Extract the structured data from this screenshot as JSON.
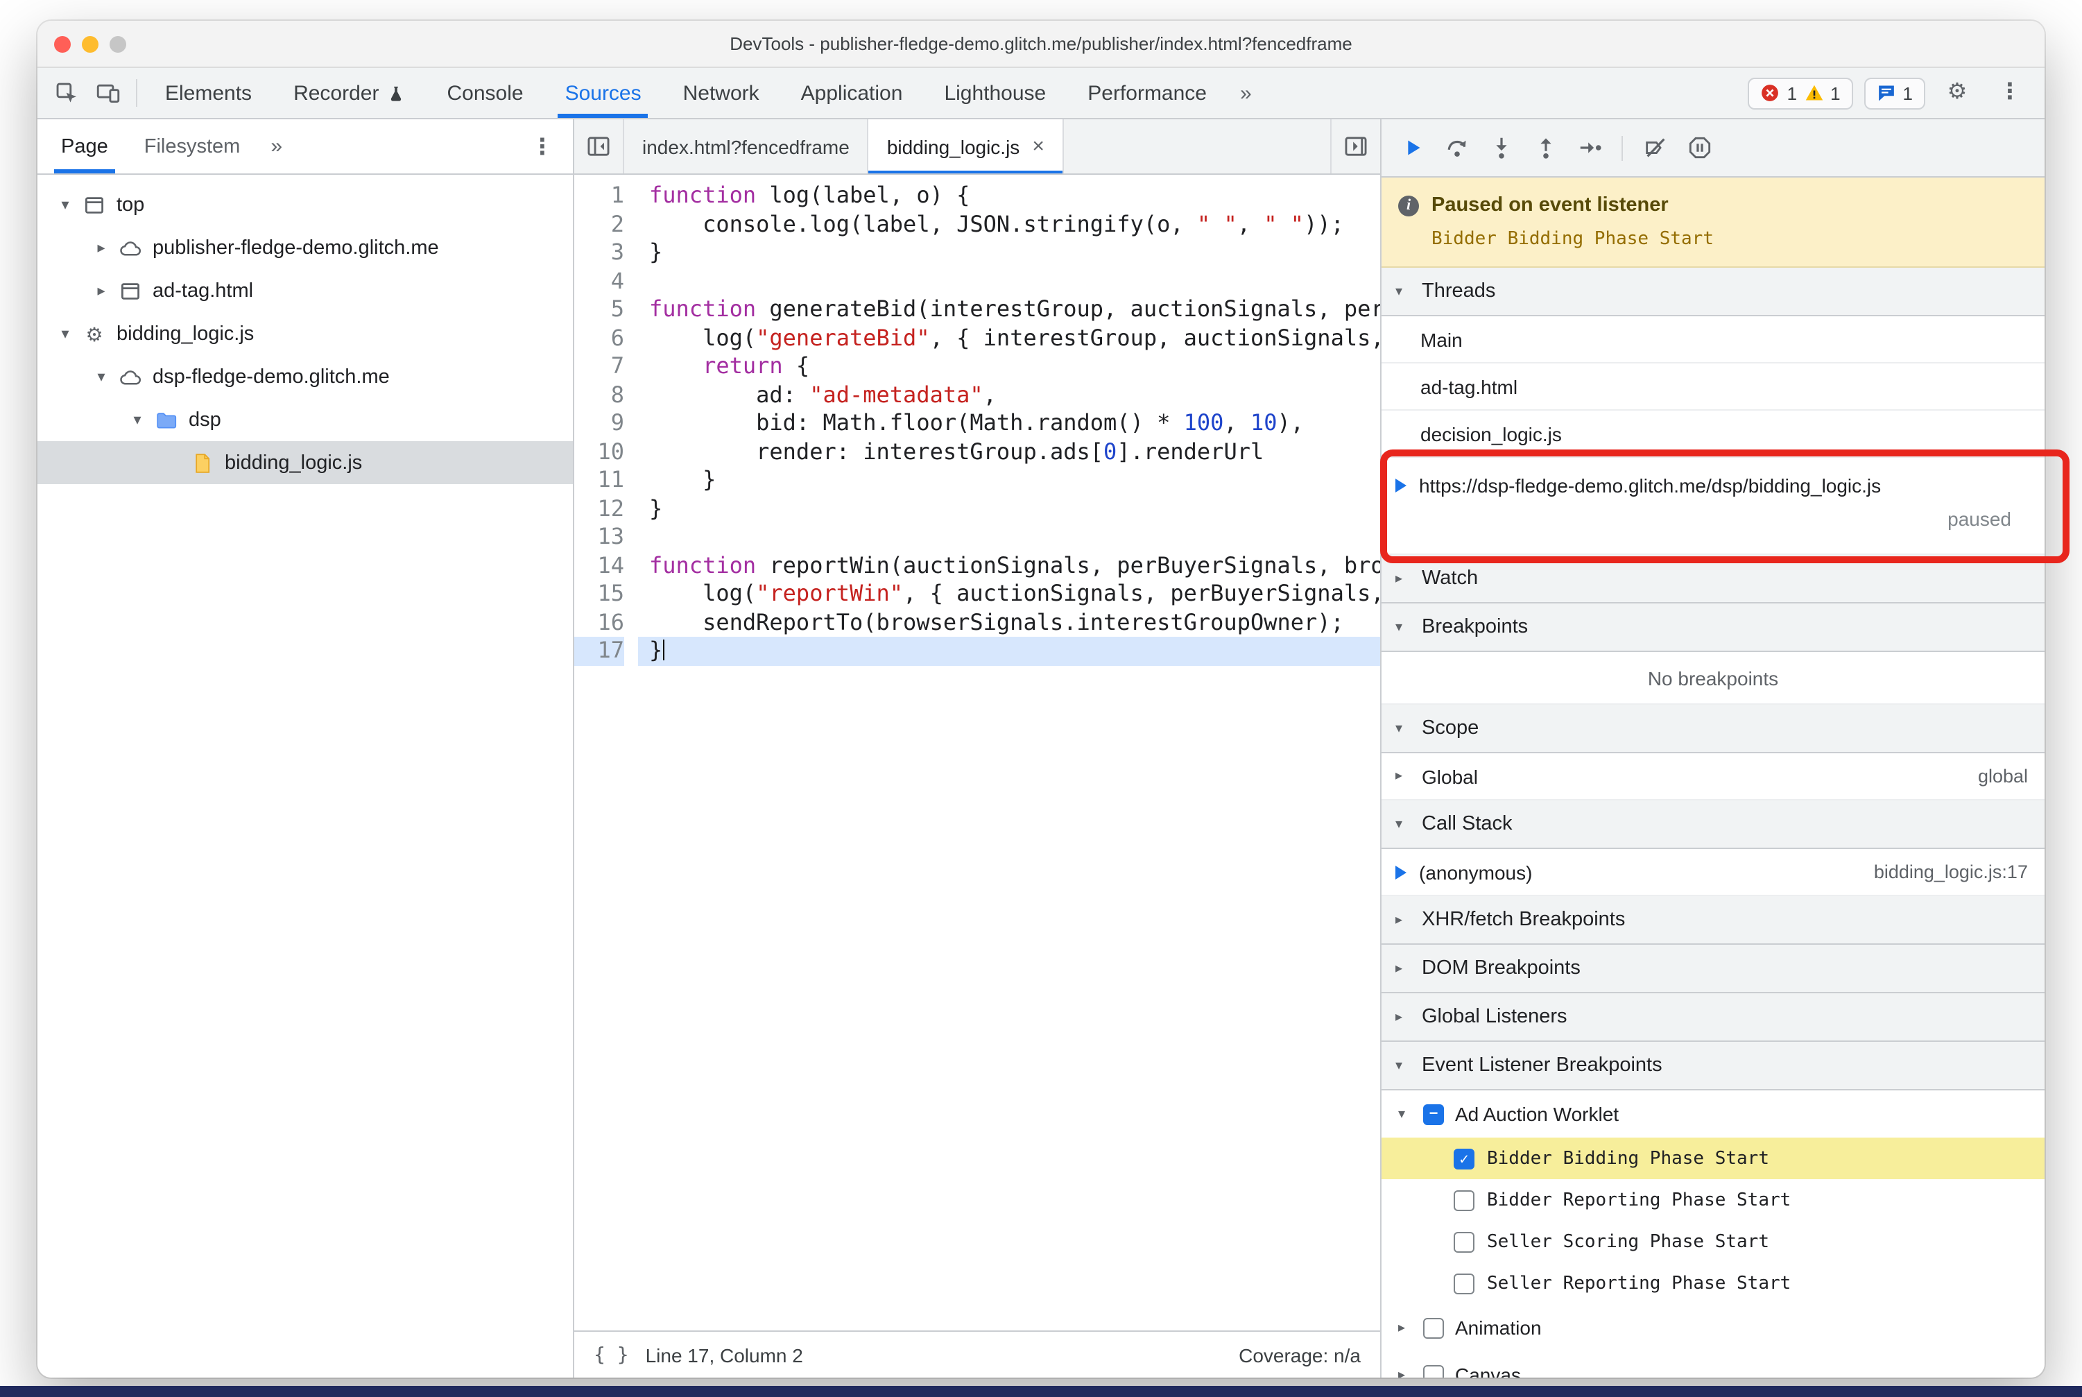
{
  "window": {
    "title": "DevTools - publisher-fledge-demo.glitch.me/publisher/index.html?fencedframe"
  },
  "toolbar": {
    "left_icons": [
      "inspect-icon",
      "device-toolbar-icon"
    ],
    "tabs": [
      "Elements",
      "Recorder",
      "Console",
      "Sources",
      "Network",
      "Application",
      "Lighthouse",
      "Performance"
    ],
    "selected_tab": "Sources",
    "overflow_label": "»",
    "badges": {
      "errors": "1",
      "warnings": "1",
      "issues": "1"
    },
    "right_icons": [
      "error-icon",
      "warning-icon",
      "issues-icon",
      "settings-gear-icon",
      "kebab-menu-icon"
    ]
  },
  "navigator": {
    "tabs": [
      "Page",
      "Filesystem"
    ],
    "selected_tab": "Page",
    "overflow_label": "»",
    "tree": [
      {
        "label": "top",
        "icon": "frame-icon",
        "arrow": "expanded",
        "indent": 0
      },
      {
        "label": "publisher-fledge-demo.glitch.me",
        "icon": "cloud-icon",
        "arrow": "collapsed",
        "indent": 1
      },
      {
        "label": "ad-tag.html",
        "icon": "frame-icon",
        "arrow": "collapsed",
        "indent": 1
      },
      {
        "label": "bidding_logic.js",
        "icon": "worklet-icon",
        "arrow": "expanded",
        "indent": 0
      },
      {
        "label": "dsp-fledge-demo.glitch.me",
        "icon": "cloud-icon",
        "arrow": "expanded",
        "indent": 1
      },
      {
        "label": "dsp",
        "icon": "folder-icon",
        "arrow": "expanded",
        "indent": 2
      },
      {
        "label": "bidding_logic.js",
        "icon": "file-icon",
        "arrow": "none",
        "indent": 3,
        "selected": true
      }
    ]
  },
  "editor": {
    "tabs": [
      {
        "label": "index.html?fencedframe",
        "selected": false
      },
      {
        "label": "bidding_logic.js",
        "selected": true,
        "close": "×"
      }
    ],
    "current_line": 17,
    "code": [
      [
        {
          "t": "function",
          "c": "kw"
        },
        {
          "t": " log(label, o) {"
        }
      ],
      [
        {
          "t": "    console.log(label, JSON.stringify(o, "
        },
        {
          "t": "\" \"",
          "c": "str"
        },
        {
          "t": ", "
        },
        {
          "t": "\" \"",
          "c": "str"
        },
        {
          "t": "));"
        }
      ],
      [
        {
          "t": "}"
        }
      ],
      [],
      [
        {
          "t": "function",
          "c": "kw"
        },
        {
          "t": " generateBid(interestGroup, auctionSignals, perBuyerSignals, trustedBiddingSignals, browserSignals) {"
        }
      ],
      [
        {
          "t": "    log("
        },
        {
          "t": "\"generateBid\"",
          "c": "str"
        },
        {
          "t": ", { interestGroup, auctionSignals, perBuyerSignals, trustedBiddingSignals, browserSignals });"
        }
      ],
      [
        {
          "t": "    "
        },
        {
          "t": "return",
          "c": "kw"
        },
        {
          "t": " {"
        }
      ],
      [
        {
          "t": "        ad: "
        },
        {
          "t": "\"ad-metadata\"",
          "c": "str"
        },
        {
          "t": ","
        }
      ],
      [
        {
          "t": "        bid: Math.floor(Math.random() * "
        },
        {
          "t": "100",
          "c": "num"
        },
        {
          "t": ", "
        },
        {
          "t": "10",
          "c": "num"
        },
        {
          "t": "),"
        }
      ],
      [
        {
          "t": "        render: interestGroup.ads["
        },
        {
          "t": "0",
          "c": "num"
        },
        {
          "t": "].renderUrl"
        }
      ],
      [
        {
          "t": "    }"
        }
      ],
      [
        {
          "t": "}"
        }
      ],
      [],
      [
        {
          "t": "function",
          "c": "kw"
        },
        {
          "t": " reportWin(auctionSignals, perBuyerSignals, browserSignals) {"
        }
      ],
      [
        {
          "t": "    log("
        },
        {
          "t": "\"reportWin\"",
          "c": "str"
        },
        {
          "t": ", { auctionSignals, perBuyerSignals, browserSignals });"
        }
      ],
      [
        {
          "t": "    sendReportTo(browserSignals.interestGroupOwner);"
        }
      ],
      [
        {
          "t": "}"
        }
      ]
    ],
    "status": {
      "line_col": "Line 17, Column 2",
      "coverage": "Coverage: n/a"
    }
  },
  "debugger": {
    "toolbar_icons": [
      "resume-icon",
      "step-over-icon",
      "step-into-icon",
      "step-out-icon",
      "step-icon",
      "deactivate-breakpoints-icon",
      "pause-on-exceptions-icon"
    ],
    "banner": {
      "title": "Paused on event listener",
      "subtitle": "Bidder Bidding Phase Start"
    },
    "threads": {
      "title": "Threads",
      "expanded": true,
      "items": [
        {
          "label": "Main"
        },
        {
          "label": "ad-tag.html"
        },
        {
          "label": "decision_logic.js"
        },
        {
          "label": "https://dsp-fledge-demo.glitch.me/dsp/bidding_logic.js",
          "active": true,
          "status": "paused",
          "annotated": true
        }
      ]
    },
    "watch": {
      "title": "Watch",
      "expanded": false
    },
    "breakpoints": {
      "title": "Breakpoints",
      "expanded": true,
      "empty_message": "No breakpoints"
    },
    "scope": {
      "title": "Scope",
      "expanded": true,
      "items": [
        {
          "label": "Global",
          "value": "global"
        }
      ]
    },
    "call_stack": {
      "title": "Call Stack",
      "expanded": true,
      "items": [
        {
          "label": "(anonymous)",
          "location": "bidding_logic.js:17",
          "active": true
        }
      ]
    },
    "collapsed_sections": [
      {
        "title": "XHR/fetch Breakpoints"
      },
      {
        "title": "DOM Breakpoints"
      },
      {
        "title": "Global Listeners"
      }
    ],
    "event_listener_breakpoints": {
      "title": "Event Listener Breakpoints",
      "expanded": true,
      "groups": [
        {
          "label": "Ad Auction Worklet",
          "checkbox": "indeterminate",
          "expanded": true,
          "items": [
            {
              "label": "Bidder Bidding Phase Start",
              "checkbox": "checked",
              "highlighted": true
            },
            {
              "label": "Bidder Reporting Phase Start",
              "checkbox": "unchecked"
            },
            {
              "label": "Seller Scoring Phase Start",
              "checkbox": "unchecked"
            },
            {
              "label": "Seller Reporting Phase Start",
              "checkbox": "unchecked"
            }
          ]
        },
        {
          "label": "Animation",
          "checkbox": "unchecked",
          "expanded": false,
          "items": []
        },
        {
          "label": "Canvas",
          "checkbox": "unchecked",
          "expanded": false,
          "items": []
        }
      ]
    },
    "annotation": {
      "type": "red-highlight-box"
    }
  },
  "icons": {
    "inspect-icon": "cursor-in-box",
    "device-toolbar-icon": "devices",
    "experiment-icon": "flask",
    "error-icon": "red-circle-x",
    "warning-icon": "yellow-triangle-exclamation",
    "issues-icon": "speech-bubble",
    "settings-gear-icon": "gear",
    "kebab-menu-icon": "three-dots",
    "info-icon": "circled-i",
    "pretty-print-icon": "curly-braces",
    "hide-navigator-icon": "panel-collapse-left",
    "open-editor-pane-icon": "panel-expand-right",
    "frame-icon": "document-frame",
    "cloud-icon": "cloud",
    "worklet-icon": "gear",
    "folder-icon": "folder",
    "file-icon": "file"
  },
  "colors": {
    "accent": "#1a73e8",
    "error": "#d93025",
    "warning": "#fbbc04",
    "annotation": "#e8261d",
    "keyword": "#a32ea1",
    "string": "#c5221f",
    "number": "#1e44cb",
    "paused_banner_bg": "#fcf0c8",
    "highlight_row_bg": "#f7ee9b",
    "exec_line_bg": "#d7e7fd",
    "selected_row_bg": "#d9dcdf",
    "traffic_close": "#ff5f57",
    "traffic_minimize": "#febc2e",
    "traffic_zoom": "#c6c6c6",
    "bottom_strip": "#202a5e"
  }
}
